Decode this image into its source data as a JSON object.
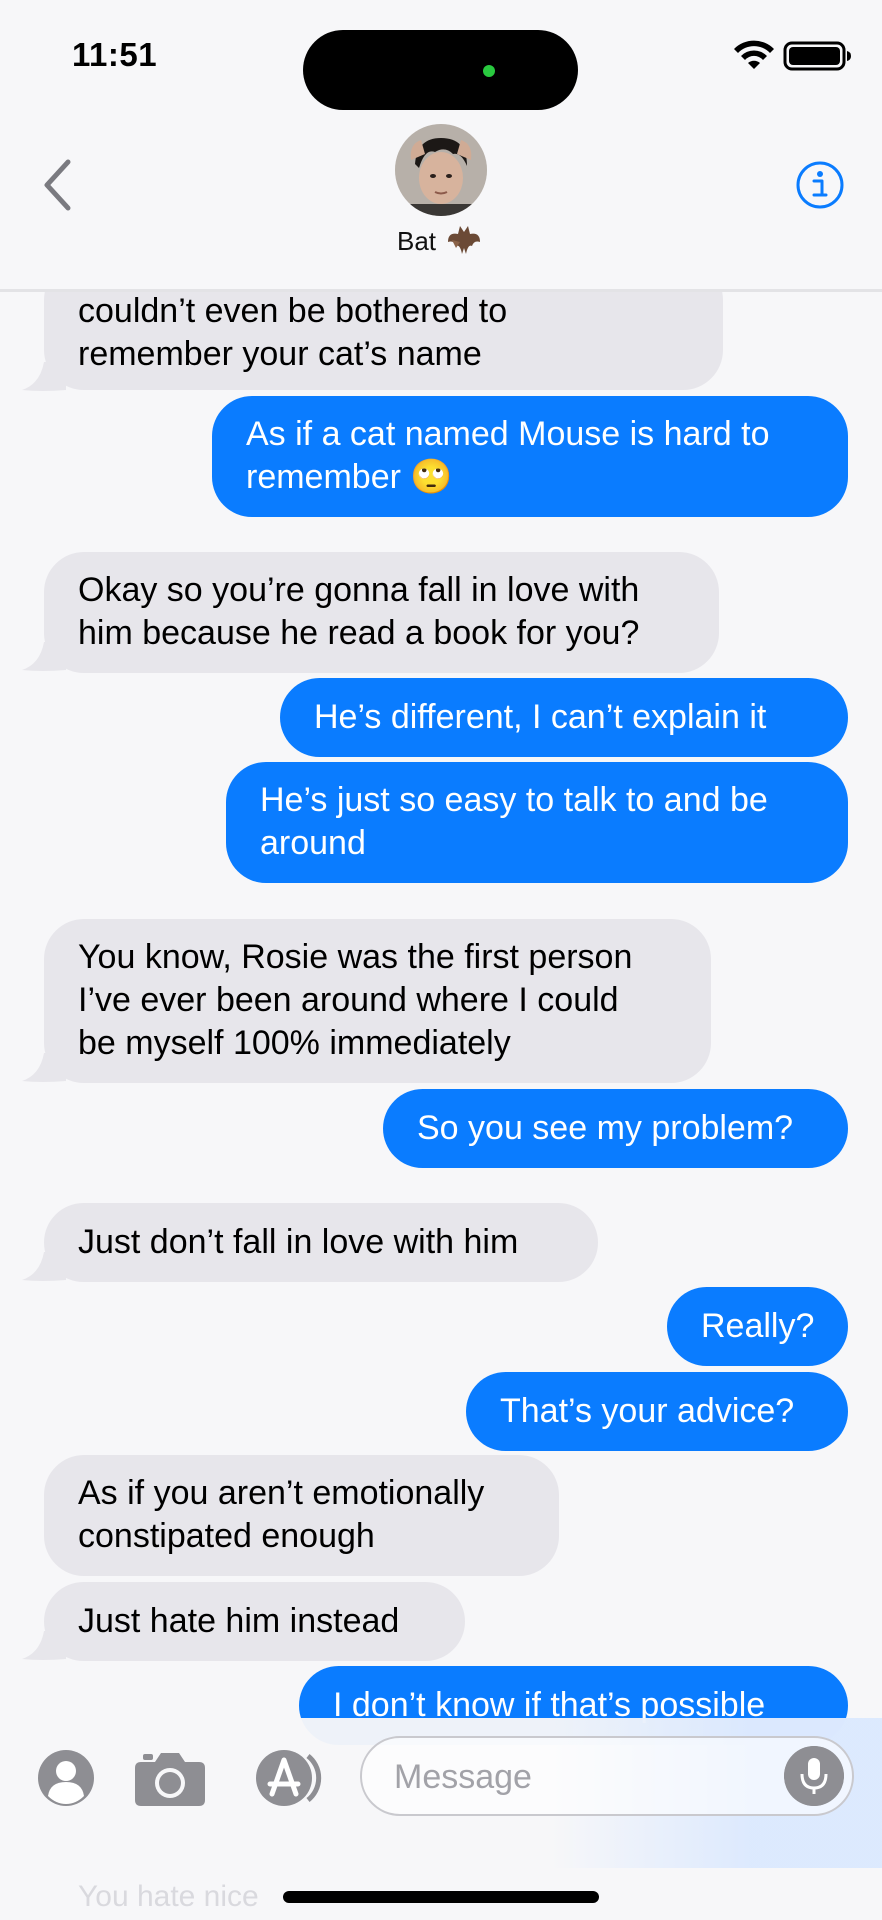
{
  "status_bar": {
    "time": "11:51"
  },
  "header": {
    "contact_name": "Bat"
  },
  "messages": [
    {
      "dir": "in",
      "lines": [
        "couldn’t even be bothered to",
        "remember your cat’s name"
      ]
    },
    {
      "dir": "out",
      "lines": [
        "As if a cat named Mouse is hard to",
        "remember 🙄"
      ]
    },
    {
      "dir": "in",
      "lines": [
        "Okay so you’re gonna fall in love with",
        "him because he read a book for you?"
      ]
    },
    {
      "dir": "out",
      "lines": [
        "He’s different, I can’t explain it"
      ]
    },
    {
      "dir": "out",
      "lines": [
        "He’s just so easy to talk to and be",
        "around"
      ]
    },
    {
      "dir": "in",
      "lines": [
        "You know, Rosie was the first person",
        "I’ve ever been around where I could",
        "be myself 100% immediately"
      ]
    },
    {
      "dir": "out",
      "lines": [
        "So you see my problem?"
      ]
    },
    {
      "dir": "in",
      "lines": [
        "Just don’t fall in love with him"
      ]
    },
    {
      "dir": "out",
      "lines": [
        "Really?"
      ]
    },
    {
      "dir": "out",
      "lines": [
        "That’s your advice?"
      ]
    },
    {
      "dir": "in",
      "lines": [
        "As if you aren’t emotionally",
        "constipated enough"
      ]
    },
    {
      "dir": "in",
      "lines": [
        "Just hate him instead"
      ]
    },
    {
      "dir": "out",
      "lines": [
        "I don’t know if that’s possible"
      ]
    }
  ],
  "composer": {
    "placeholder": "Message",
    "ghost_text": "You hate nice"
  },
  "colors": {
    "outgoing_bubble": "#0a7cff",
    "incoming_bubble": "#e7e6eb",
    "accent": "#0a7cff"
  },
  "icons": {
    "back": "chevron-left-icon",
    "info": "info-icon",
    "contacts": "person-icon",
    "camera": "camera-icon",
    "apps": "app-store-icon",
    "mic": "microphone-icon"
  }
}
